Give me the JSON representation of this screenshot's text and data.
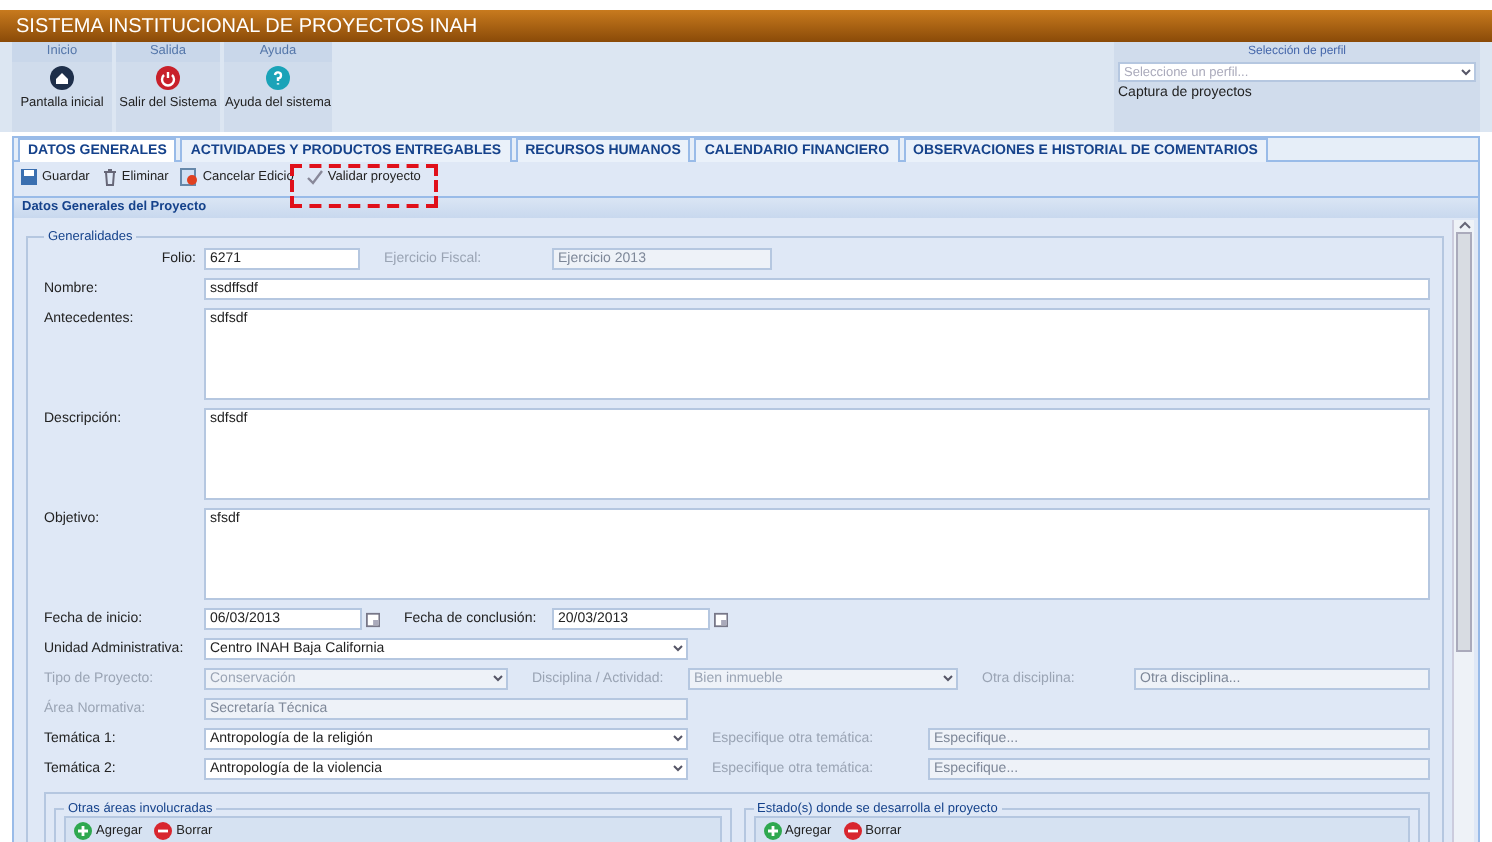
{
  "app": {
    "title": "SISTEMA INSTITUCIONAL DE PROYECTOS INAH"
  },
  "ribbon": {
    "groups": [
      {
        "header": "Inicio",
        "label": "Pantalla inicial",
        "kind": "home"
      },
      {
        "header": "Salida",
        "label": "Salir del Sistema",
        "kind": "exit"
      },
      {
        "header": "Ayuda",
        "label": "Ayuda del sistema",
        "kind": "help"
      }
    ]
  },
  "profile": {
    "header": "Selección de perfil",
    "placeholder": "Seleccione un perfil...",
    "caption": "Captura de proyectos"
  },
  "tabs": [
    {
      "label": "DATOS GENERALES",
      "selected": true
    },
    {
      "label": "ACTIVIDADES Y PRODUCTOS ENTREGABLES",
      "selected": false
    },
    {
      "label": "RECURSOS HUMANOS",
      "selected": false
    },
    {
      "label": "CALENDARIO FINANCIERO",
      "selected": false
    },
    {
      "label": "OBSERVACIONES E HISTORIAL DE COMENTARIOS",
      "selected": false
    }
  ],
  "toolbar": {
    "buttons": [
      {
        "label": "Guardar",
        "kind": "save",
        "highlighted": false
      },
      {
        "label": "Eliminar",
        "kind": "delete",
        "highlighted": false
      },
      {
        "label": "Cancelar Edicio",
        "kind": "cancel",
        "highlighted": false
      },
      {
        "label": "Validar proyecto",
        "kind": "validate",
        "highlighted": true
      }
    ]
  },
  "panel": {
    "title": "Datos Generales del Proyecto",
    "fieldset": {
      "legend": "Generalidades",
      "rows": [
        {
          "kind": "folio",
          "label": "Folio:",
          "disabled": false,
          "items": [
            {
              "kind": "input",
              "value": "6271",
              "disabled": false
            },
            {
              "kind": "caption",
              "text": "Ejercicio Fiscal:",
              "disabled": true
            },
            {
              "kind": "input",
              "value": "Ejercicio 2013",
              "disabled": true
            }
          ]
        },
        {
          "kind": "text",
          "label": "Nombre:",
          "disabled": false,
          "items": [
            {
              "kind": "input",
              "value": "ssdffsdf",
              "disabled": false
            }
          ]
        },
        {
          "kind": "textarea",
          "label": "Antecedentes:",
          "disabled": false,
          "items": [
            {
              "kind": "textarea",
              "value": "sdfsdf"
            }
          ]
        },
        {
          "kind": "textarea",
          "label": "Descripción:",
          "disabled": false,
          "items": [
            {
              "kind": "textarea",
              "value": "sdfsdf"
            }
          ]
        },
        {
          "kind": "textarea",
          "label": "Objetivo:",
          "disabled": false,
          "items": [
            {
              "kind": "textarea",
              "value": "sfsdf"
            }
          ]
        },
        {
          "kind": "dates",
          "label": "Fecha de inicio:",
          "disabled": false,
          "items": [
            {
              "kind": "date",
              "value": "06/03/2013",
              "disabled": false
            },
            {
              "kind": "caption",
              "text": "Fecha de conclusión:",
              "disabled": false
            },
            {
              "kind": "date",
              "value": "20/03/2013",
              "disabled": false
            }
          ]
        },
        {
          "kind": "select",
          "label": "Unidad Administrativa:",
          "disabled": false,
          "items": [
            {
              "kind": "select",
              "value": "Centro INAH Baja California",
              "disabled": false
            }
          ]
        },
        {
          "kind": "triple",
          "label": "Tipo de Proyecto:",
          "disabled": true,
          "items": [
            {
              "kind": "select",
              "value": "Conservación",
              "disabled": true
            },
            {
              "kind": "caption",
              "text": "Disciplina / Actividad:",
              "disabled": true
            },
            {
              "kind": "select",
              "value": "Bien inmueble",
              "disabled": true
            },
            {
              "kind": "caption",
              "text": "Otra disciplina:",
              "disabled": true
            },
            {
              "kind": "input",
              "placeholder": "Otra disciplina...",
              "disabled": true
            }
          ]
        },
        {
          "kind": "select",
          "label": "Área Normativa:",
          "disabled": true,
          "items": [
            {
              "kind": "input",
              "value": "Secretaría Técnica",
              "disabled": true
            }
          ]
        },
        {
          "kind": "tematica",
          "label": "Temática 1:",
          "disabled": false,
          "items": [
            {
              "kind": "select",
              "value": "Antropología de la religión",
              "disabled": false
            },
            {
              "kind": "caption",
              "text": "Especifique otra temática:",
              "disabled": true
            },
            {
              "kind": "input",
              "placeholder": "Especifique...",
              "disabled": true
            }
          ]
        },
        {
          "kind": "tematica",
          "label": "Temática 2:",
          "disabled": false,
          "items": [
            {
              "kind": "select",
              "value": "Antropología de la violencia",
              "disabled": false
            },
            {
              "kind": "caption",
              "text": "Especifique otra temática:",
              "disabled": true
            },
            {
              "kind": "input",
              "placeholder": "Especifique...",
              "disabled": true
            }
          ]
        }
      ],
      "subsets": [
        {
          "legend": "Otras áreas involucradas",
          "buttons": [
            {
              "label": "Agregar",
              "kind": "add"
            },
            {
              "label": "Borrar",
              "kind": "remove"
            }
          ]
        },
        {
          "legend": "Estado(s) donde se desarrolla el proyecto",
          "buttons": [
            {
              "label": "Agregar",
              "kind": "add"
            },
            {
              "label": "Borrar",
              "kind": "remove"
            }
          ]
        }
      ]
    }
  }
}
